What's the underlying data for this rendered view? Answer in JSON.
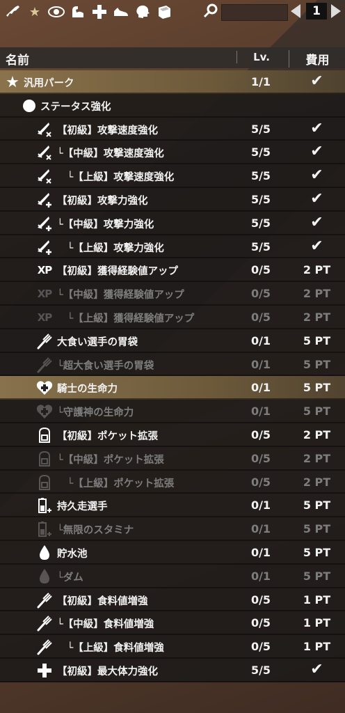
{
  "toolbar": {
    "icons": [
      "rifle-icon",
      "star-icon",
      "eye-icon",
      "muscle-icon",
      "cross-icon",
      "shoe-icon",
      "brain-icon",
      "book-icon"
    ],
    "page_number": "1"
  },
  "table": {
    "headers": {
      "name": "名前",
      "level": "Lv.",
      "cost": "費用"
    },
    "rows": [
      {
        "icon": "star-icon",
        "indent": 0,
        "label": "汎用パーク",
        "lv": "1/1",
        "cost": "✔",
        "selected": true,
        "dim": false
      },
      {
        "icon": "circle-icon",
        "indent": 1,
        "label": "ステータス強化",
        "lv": "",
        "cost": "",
        "selected": false,
        "dim": false
      },
      {
        "icon": "sword-x-icon",
        "indent": 2,
        "label": "【初級】攻撃速度強化",
        "lv": "5/5",
        "cost": "✔",
        "selected": false,
        "dim": false
      },
      {
        "icon": "sword-x-icon",
        "indent": 2,
        "label": "└【中級】攻撃速度強化",
        "lv": "5/5",
        "cost": "✔",
        "selected": false,
        "dim": false
      },
      {
        "icon": "sword-x-icon",
        "indent": 2,
        "label": "　└【上級】攻撃速度強化",
        "lv": "5/5",
        "cost": "✔",
        "selected": false,
        "dim": false
      },
      {
        "icon": "sword-plus-icon",
        "indent": 2,
        "label": "【初級】攻撃力強化",
        "lv": "5/5",
        "cost": "✔",
        "selected": false,
        "dim": false
      },
      {
        "icon": "sword-plus-icon",
        "indent": 2,
        "label": "└【中級】攻撃力強化",
        "lv": "5/5",
        "cost": "✔",
        "selected": false,
        "dim": false
      },
      {
        "icon": "sword-plus-icon",
        "indent": 2,
        "label": "　└【上級】攻撃力強化",
        "lv": "5/5",
        "cost": "✔",
        "selected": false,
        "dim": false
      },
      {
        "icon": "xp-icon",
        "indent": 2,
        "label": "【初級】獲得経験値アップ",
        "lv": "0/5",
        "cost": "2 PT",
        "selected": false,
        "dim": false
      },
      {
        "icon": "xp-icon",
        "indent": 2,
        "label": "└【中級】獲得経験値アップ",
        "lv": "0/5",
        "cost": "2 PT",
        "selected": false,
        "dim": true
      },
      {
        "icon": "xp-icon",
        "indent": 2,
        "label": "　└【上級】獲得経験値アップ",
        "lv": "0/5",
        "cost": "2 PT",
        "selected": false,
        "dim": true
      },
      {
        "icon": "fork-icon",
        "indent": 2,
        "label": "大食い選手の胃袋",
        "lv": "0/1",
        "cost": "5 PT",
        "selected": false,
        "dim": false
      },
      {
        "icon": "fork-icon",
        "indent": 2,
        "label": "└超大食い選手の胃袋",
        "lv": "0/1",
        "cost": "5 PT",
        "selected": false,
        "dim": true
      },
      {
        "icon": "heart-icon",
        "indent": 2,
        "label": "騎士の生命力",
        "lv": "0/1",
        "cost": "5 PT",
        "selected": true,
        "dim": false
      },
      {
        "icon": "heart-icon",
        "indent": 2,
        "label": "└守護神の生命力",
        "lv": "0/1",
        "cost": "5 PT",
        "selected": false,
        "dim": true
      },
      {
        "icon": "backpack-icon",
        "indent": 2,
        "label": "【初級】ポケット拡張",
        "lv": "0/5",
        "cost": "2 PT",
        "selected": false,
        "dim": false
      },
      {
        "icon": "backpack-icon",
        "indent": 2,
        "label": "└【中級】ポケット拡張",
        "lv": "0/5",
        "cost": "2 PT",
        "selected": false,
        "dim": true
      },
      {
        "icon": "backpack-icon",
        "indent": 2,
        "label": "　└【上級】ポケット拡張",
        "lv": "0/5",
        "cost": "2 PT",
        "selected": false,
        "dim": true
      },
      {
        "icon": "battery-icon",
        "indent": 2,
        "label": "持久走選手",
        "lv": "0/1",
        "cost": "5 PT",
        "selected": false,
        "dim": false
      },
      {
        "icon": "battery-icon",
        "indent": 2,
        "label": "└無限のスタミナ",
        "lv": "0/1",
        "cost": "5 PT",
        "selected": false,
        "dim": true
      },
      {
        "icon": "drop-icon",
        "indent": 2,
        "label": "貯水池",
        "lv": "0/1",
        "cost": "5 PT",
        "selected": false,
        "dim": false
      },
      {
        "icon": "drop-icon",
        "indent": 2,
        "label": "└ダム",
        "lv": "0/1",
        "cost": "5 PT",
        "selected": false,
        "dim": true
      },
      {
        "icon": "fork-icon",
        "indent": 2,
        "label": "【初級】食料値増強",
        "lv": "0/5",
        "cost": "1 PT",
        "selected": false,
        "dim": false
      },
      {
        "icon": "fork-icon",
        "indent": 2,
        "label": "└【中級】食料値増強",
        "lv": "0/5",
        "cost": "1 PT",
        "selected": false,
        "dim": false
      },
      {
        "icon": "fork-icon",
        "indent": 2,
        "label": "　└【上級】食料値増強",
        "lv": "0/5",
        "cost": "1 PT",
        "selected": false,
        "dim": false
      },
      {
        "icon": "cross-icon",
        "indent": 2,
        "label": "【初級】最大体力強化",
        "lv": "5/5",
        "cost": "✔",
        "selected": false,
        "dim": false
      }
    ]
  }
}
